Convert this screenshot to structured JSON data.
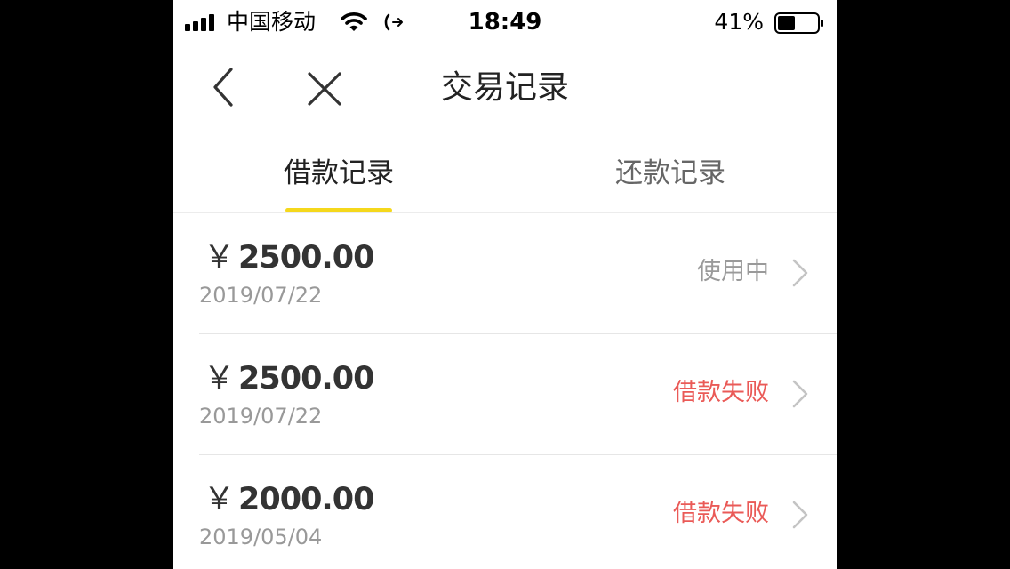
{
  "status_bar": {
    "carrier": "中国移动",
    "time": "18:49",
    "battery_percent": "41%",
    "icons": [
      "signal-icon",
      "wifi-icon",
      "call-forward-icon",
      "battery-icon"
    ]
  },
  "nav": {
    "title": "交易记录",
    "back_icon": "chevron-left-icon",
    "close_icon": "close-icon"
  },
  "tabs": [
    {
      "label": "借款记录",
      "active": true
    },
    {
      "label": "还款记录",
      "active": false
    }
  ],
  "records": [
    {
      "currency": "￥",
      "amount": "2500.00",
      "date": "2019/07/22",
      "status": "使用中",
      "status_color": "#9a9a9a"
    },
    {
      "currency": "￥",
      "amount": "2500.00",
      "date": "2019/07/22",
      "status": "借款失败",
      "status_color": "#ea5a57"
    },
    {
      "currency": "￥",
      "amount": "2000.00",
      "date": "2019/05/04",
      "status": "借款失败",
      "status_color": "#ea5a57"
    }
  ],
  "colors": {
    "accent": "#f5d81c",
    "status_in_use": "#9a9a9a",
    "status_failed": "#ea5a57"
  }
}
